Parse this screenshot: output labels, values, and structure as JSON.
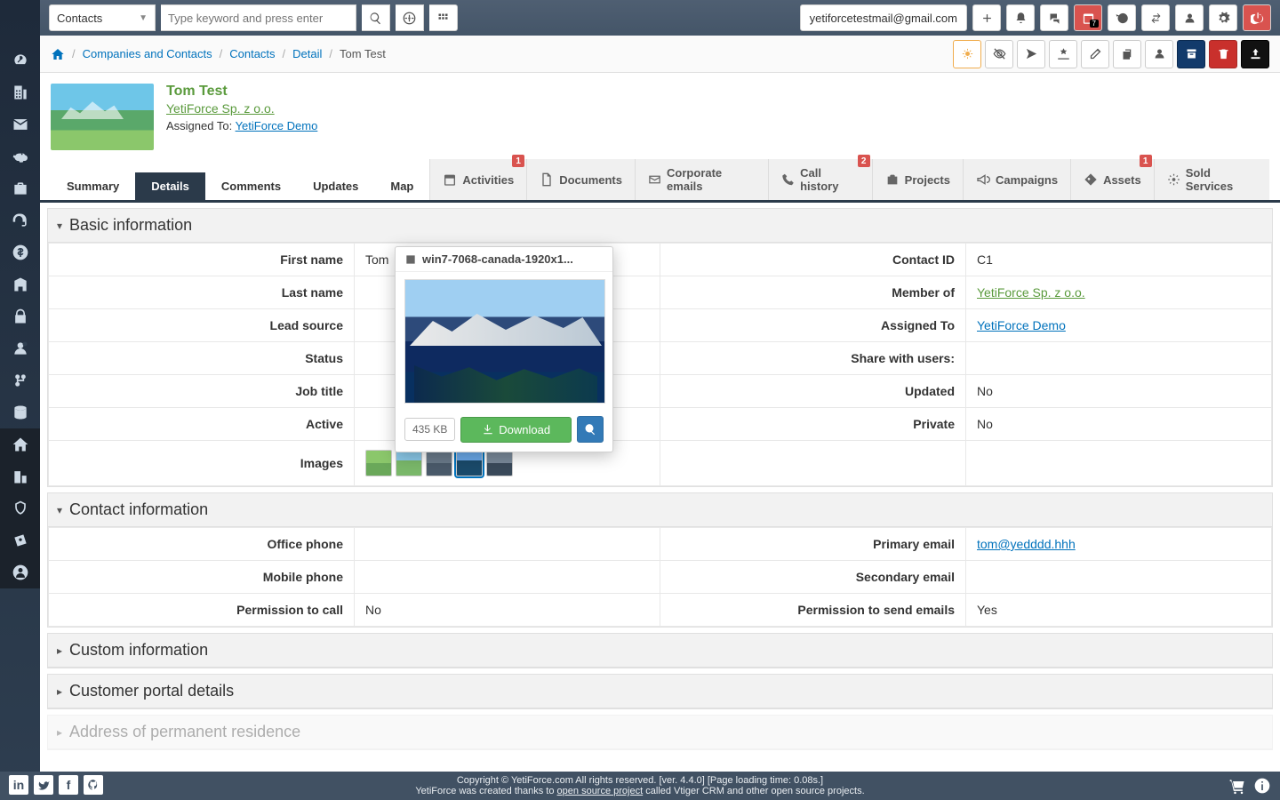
{
  "topbar": {
    "module": "Contacts",
    "search_placeholder": "Type keyword and press enter",
    "user_email": "yetiforcetestmail@gmail.com",
    "calendar_badge": "7"
  },
  "breadcrumb": {
    "home": "",
    "parts": [
      "Companies and Contacts",
      "Contacts",
      "Detail"
    ],
    "current": "Tom Test"
  },
  "record": {
    "name": "Tom Test",
    "company": "YetiForce Sp. z o.o.",
    "assigned_label": "Assigned To: ",
    "assigned_value": "YetiForce Demo"
  },
  "tabs": {
    "left": [
      "Summary",
      "Details",
      "Comments",
      "Updates",
      "Map"
    ],
    "right": [
      {
        "label": "Activities",
        "icon": "calendar",
        "badge": "1"
      },
      {
        "label": "Documents",
        "icon": "doc"
      },
      {
        "label": "Corporate emails",
        "icon": "mail"
      },
      {
        "label": "Call history",
        "icon": "phone",
        "badge": "2"
      },
      {
        "label": "Projects",
        "icon": "briefcase"
      },
      {
        "label": "Campaigns",
        "icon": "megaphone"
      },
      {
        "label": "Assets",
        "icon": "price",
        "badge": "1"
      },
      {
        "label": "Sold Services",
        "icon": "gear"
      }
    ]
  },
  "panels": {
    "basic": {
      "title": "Basic information",
      "rows": [
        {
          "l1": "First name",
          "v1": "Tom",
          "l2": "Contact ID",
          "v2": "C1"
        },
        {
          "l1": "Last name",
          "v1": "",
          "l2": "Member of",
          "v2": "YetiForce Sp. z o.o.",
          "v2_class": "green"
        },
        {
          "l1": "Lead source",
          "v1": "",
          "l2": "Assigned To",
          "v2": "YetiForce Demo",
          "v2_link": true
        },
        {
          "l1": "Status",
          "v1": "",
          "l2": "Share with users:",
          "v2": ""
        },
        {
          "l1": "Job title",
          "v1": "",
          "l2": "Updated",
          "v2": "No"
        },
        {
          "l1": "Active",
          "v1": "",
          "l2": "Private",
          "v2": "No"
        },
        {
          "l1": "Images",
          "l2": "",
          "v2": ""
        }
      ]
    },
    "contact": {
      "title": "Contact information",
      "rows": [
        {
          "l1": "Office phone",
          "v1": "",
          "l2": "Primary email",
          "v2": "tom@yedddd.hhh",
          "v2_link": true
        },
        {
          "l1": "Mobile phone",
          "v1": "",
          "l2": "Secondary email",
          "v2": ""
        },
        {
          "l1": "Permission to call",
          "v1": "No",
          "l2": "Permission to send emails",
          "v2": "Yes"
        }
      ]
    },
    "custom": {
      "title": "Custom information"
    },
    "portal": {
      "title": "Customer portal details"
    },
    "address": {
      "title": "Address of permanent residence"
    }
  },
  "popup": {
    "filename": "win7-7068-canada-1920x1...",
    "size": "435 KB",
    "download": "Download"
  },
  "footer": {
    "line1": "Copyright © YetiForce.com All rights reserved. [ver. 4.4.0] [Page loading time: 0.08s.]",
    "line2_a": "YetiForce was created thanks to ",
    "line2_link": "open source project",
    "line2_b": " called Vtiger CRM and other open source projects."
  }
}
